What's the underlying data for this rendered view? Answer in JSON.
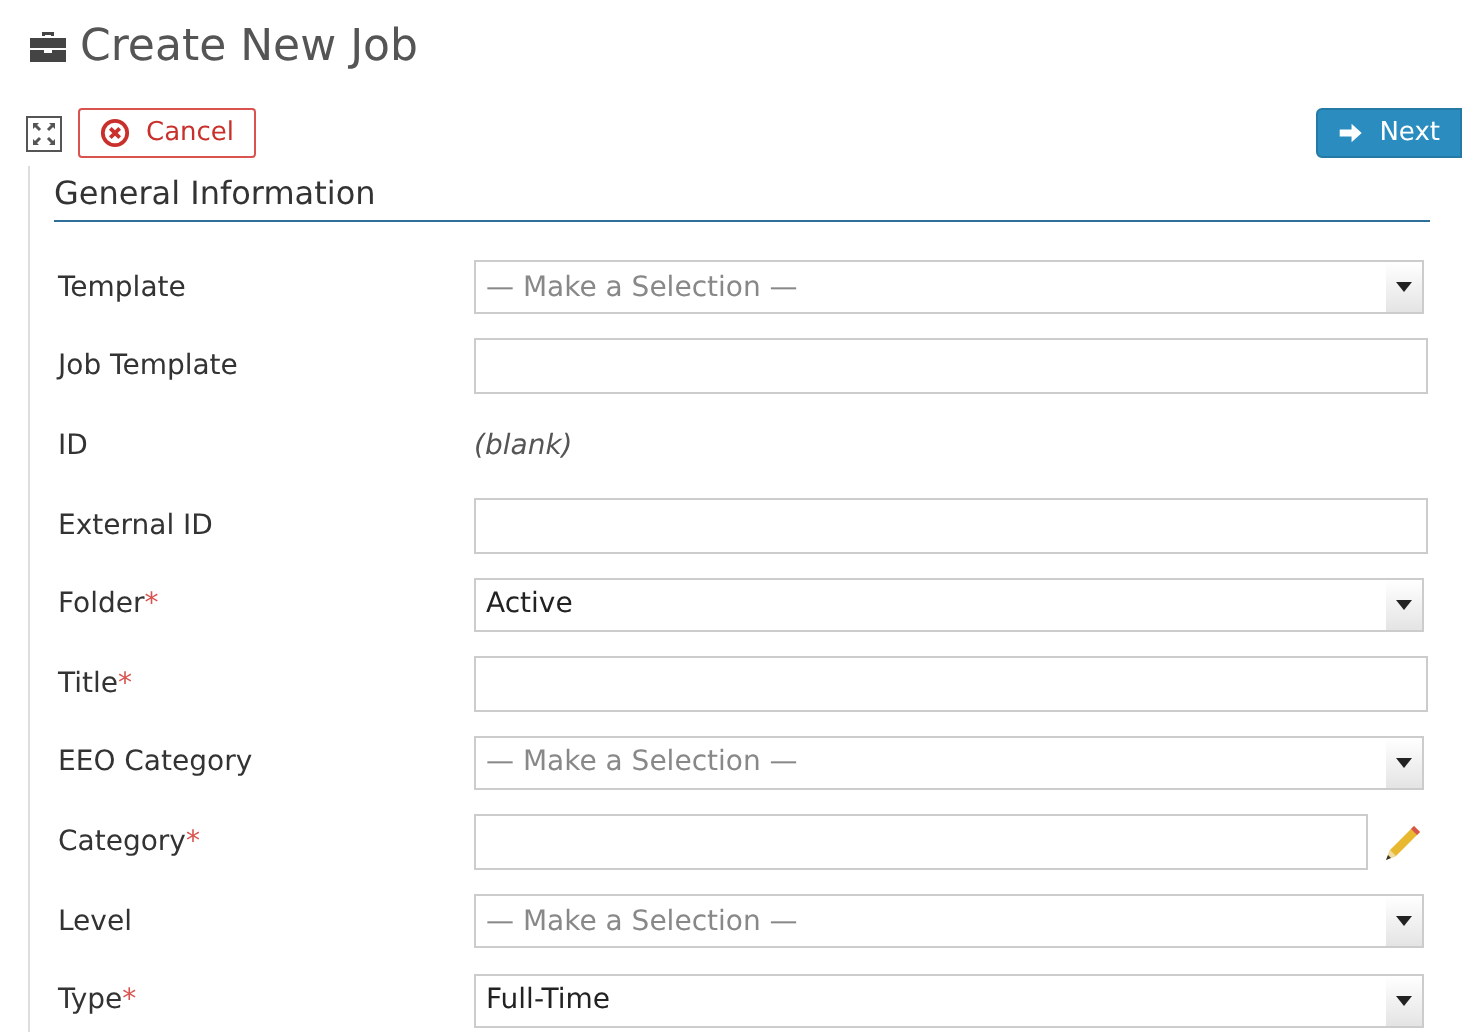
{
  "page": {
    "title": "Create New Job"
  },
  "toolbar": {
    "cancel": "Cancel",
    "next": "Next"
  },
  "section": {
    "title": "General Information"
  },
  "fields": [
    {
      "kind": "select",
      "label": "Template",
      "placeholder": "— Make a Selection —"
    },
    {
      "kind": "text",
      "label": "Job Template"
    },
    {
      "kind": "static",
      "label": "ID",
      "value": "(blank)"
    },
    {
      "kind": "text",
      "label": "External ID"
    },
    {
      "kind": "select",
      "label": "Folder",
      "required_mark": "*",
      "value": "Active"
    },
    {
      "kind": "text",
      "label": "Title",
      "required_mark": "*"
    },
    {
      "kind": "select",
      "label": "EEO Category",
      "placeholder": "— Make a Selection —"
    },
    {
      "kind": "edit",
      "label": "Category",
      "required_mark": "*"
    },
    {
      "kind": "select",
      "label": "Level",
      "placeholder": "— Make a Selection —"
    },
    {
      "kind": "select",
      "label": "Type",
      "required_mark": "*",
      "value": "Full-Time"
    }
  ]
}
